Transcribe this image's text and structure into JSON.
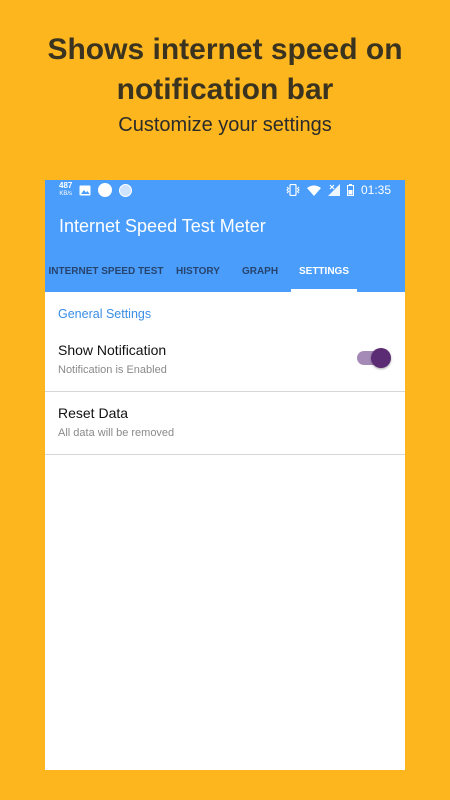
{
  "promo": {
    "headline_line1": "Shows internet speed on",
    "headline_line2": "notification bar",
    "subheadline": "Customize your settings"
  },
  "status_bar": {
    "speed_value": "487",
    "speed_unit": "KB/s",
    "time": "01:35"
  },
  "app": {
    "title": "Internet Speed Test Meter",
    "tabs": [
      {
        "label": "INTERNET SPEED TEST",
        "active": false
      },
      {
        "label": "HISTORY",
        "active": false
      },
      {
        "label": "GRAPH",
        "active": false
      },
      {
        "label": "SETTINGS",
        "active": true
      }
    ]
  },
  "settings": {
    "section_title": "General Settings",
    "items": [
      {
        "title": "Show Notification",
        "summary": "Notification is Enabled",
        "toggle": true
      },
      {
        "title": "Reset Data",
        "summary": "All data will be removed"
      }
    ]
  },
  "colors": {
    "background": "#FDB61D",
    "app_bar": "#4A9DFB",
    "switch_thumb": "#5B2B73",
    "section_header": "#3A8EE6"
  }
}
